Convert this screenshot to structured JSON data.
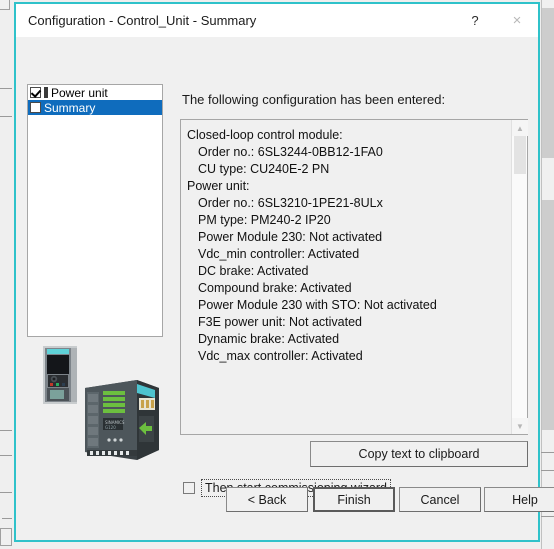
{
  "window": {
    "title": "Configuration - Control_Unit - Summary",
    "help_button": "?",
    "close_button": "×",
    "accent_border": "#2fc2ca"
  },
  "tree": {
    "items": [
      {
        "label": "Power unit",
        "checked": true,
        "selected": false
      },
      {
        "label": "Summary",
        "checked": false,
        "selected": true
      }
    ],
    "selected_color": "#0f6cbd"
  },
  "content": {
    "heading": "The following configuration has been entered:",
    "lines": [
      {
        "text": "Closed-loop control module:",
        "indent": false
      },
      {
        "text": "Order no.: 6SL3244-0BB12-1FA0",
        "indent": true
      },
      {
        "text": "CU type: CU240E-2 PN",
        "indent": true
      },
      {
        "text": "Power unit:",
        "indent": false
      },
      {
        "text": "Order no.: 6SL3210-1PE21-8ULx",
        "indent": true
      },
      {
        "text": "PM type: PM240-2 IP20",
        "indent": true
      },
      {
        "text": "Power Module 230: Not activated",
        "indent": true
      },
      {
        "text": "Vdc_min controller: Activated",
        "indent": true
      },
      {
        "text": "DC brake: Activated",
        "indent": true
      },
      {
        "text": "Compound brake: Activated",
        "indent": true
      },
      {
        "text": "Power Module 230 with STO: Not activated",
        "indent": true
      },
      {
        "text": "F3E power unit: Not activated",
        "indent": true
      },
      {
        "text": "Dynamic brake: Activated",
        "indent": true
      },
      {
        "text": "Vdc_max controller: Activated",
        "indent": true
      }
    ]
  },
  "scrollbar": {
    "up_arrow": "▲",
    "down_arrow": "▼"
  },
  "actions": {
    "copy_label": "Copy text to clipboard",
    "wizard_checkbox_label": "Then start commissioning wizard",
    "wizard_checkbox_checked": false
  },
  "footer": {
    "back": "< Back",
    "finish": "Finish",
    "cancel": "Cancel",
    "help": "Help"
  }
}
